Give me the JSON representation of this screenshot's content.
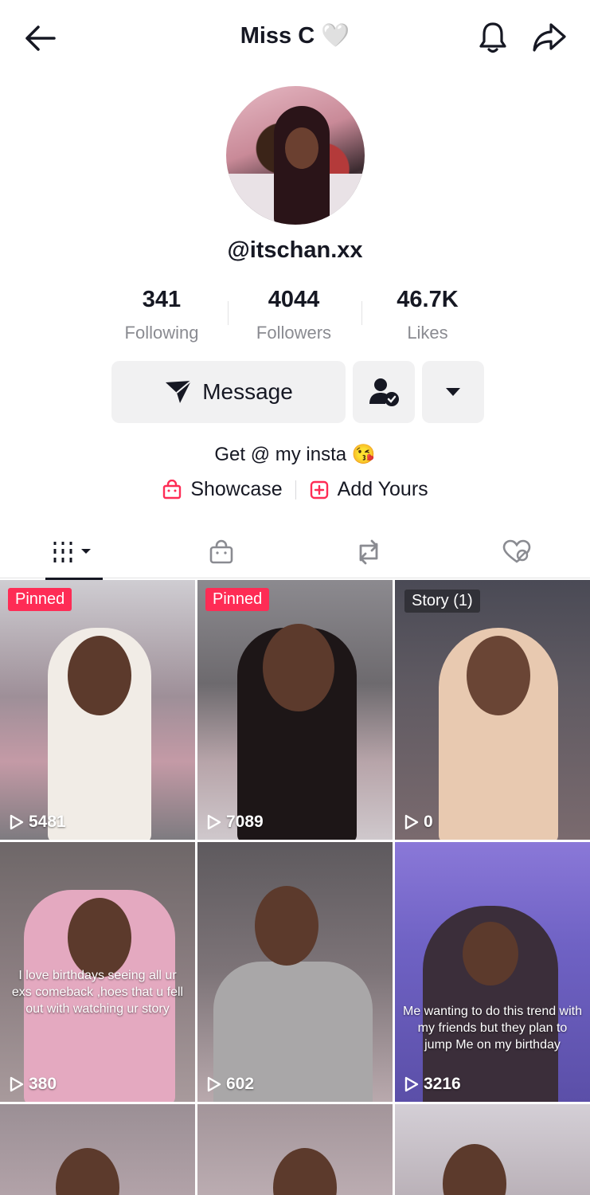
{
  "header": {
    "title": "Miss C",
    "title_emoji": "🤍",
    "back_icon": "arrow-left-icon",
    "bell_icon": "bell-icon",
    "share_icon": "share-arrow-icon"
  },
  "profile": {
    "username": "@itschan.xx",
    "bio": "Get @ my insta 😘"
  },
  "stats": [
    {
      "value": "341",
      "label": "Following"
    },
    {
      "value": "4044",
      "label": "Followers"
    },
    {
      "value": "46.7K",
      "label": "Likes"
    }
  ],
  "actions": {
    "message_label": "Message",
    "follow_icon": "user-check-icon",
    "more_icon": "caret-down-icon"
  },
  "links": {
    "showcase_label": "Showcase",
    "add_yours_label": "Add Yours"
  },
  "tabs": [
    {
      "icon": "grid-videos-icon",
      "active": true
    },
    {
      "icon": "shopping-bag-icon",
      "active": false
    },
    {
      "icon": "repost-icon",
      "active": false
    },
    {
      "icon": "liked-hidden-icon",
      "active": false
    }
  ],
  "videos": [
    {
      "badge": "Pinned",
      "badge_type": "pinned",
      "views": "5481",
      "caption": ""
    },
    {
      "badge": "Pinned",
      "badge_type": "pinned",
      "views": "7089",
      "caption": ""
    },
    {
      "badge": "Story (1)",
      "badge_type": "story",
      "views": "0",
      "caption": ""
    },
    {
      "badge": "",
      "badge_type": "",
      "views": "380",
      "caption": "I love birthdays seeing all ur exs comeback ,hoes that u fell out with watching ur story"
    },
    {
      "badge": "",
      "badge_type": "",
      "views": "602",
      "caption": ""
    },
    {
      "badge": "",
      "badge_type": "",
      "views": "3216",
      "caption": "Me wanting to do this trend with my friends but they plan to jump Me on my birthday"
    }
  ],
  "colors": {
    "accent": "#fe2c55",
    "button_bg": "#f1f1f2",
    "text_primary": "#161823",
    "text_secondary": "#8a8b91"
  }
}
